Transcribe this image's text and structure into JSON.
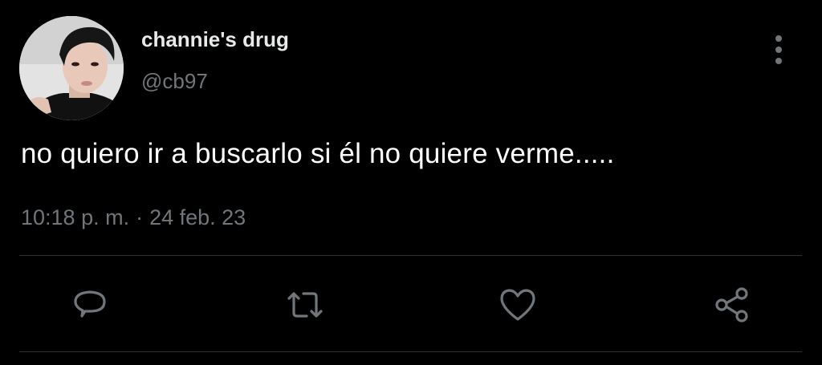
{
  "tweet": {
    "author": {
      "display_name": "channie's drug",
      "handle": "@cb97",
      "avatar_icon": "profile-photo"
    },
    "text": "no quiero ir a buscarlo si él no quiere verme.....",
    "time": "10:18 p. m.",
    "separator": "·",
    "date": "24 feb. 23",
    "more_icon": "vertical-ellipsis-icon"
  },
  "actions": {
    "reply_icon": "speech-bubble-icon",
    "retweet_icon": "retweet-arrows-icon",
    "like_icon": "heart-icon",
    "share_icon": "share-nodes-icon"
  },
  "colors": {
    "background": "#000000",
    "primary_text": "#e7e9ea",
    "secondary_text": "#71767b",
    "divider": "#2f3336"
  }
}
